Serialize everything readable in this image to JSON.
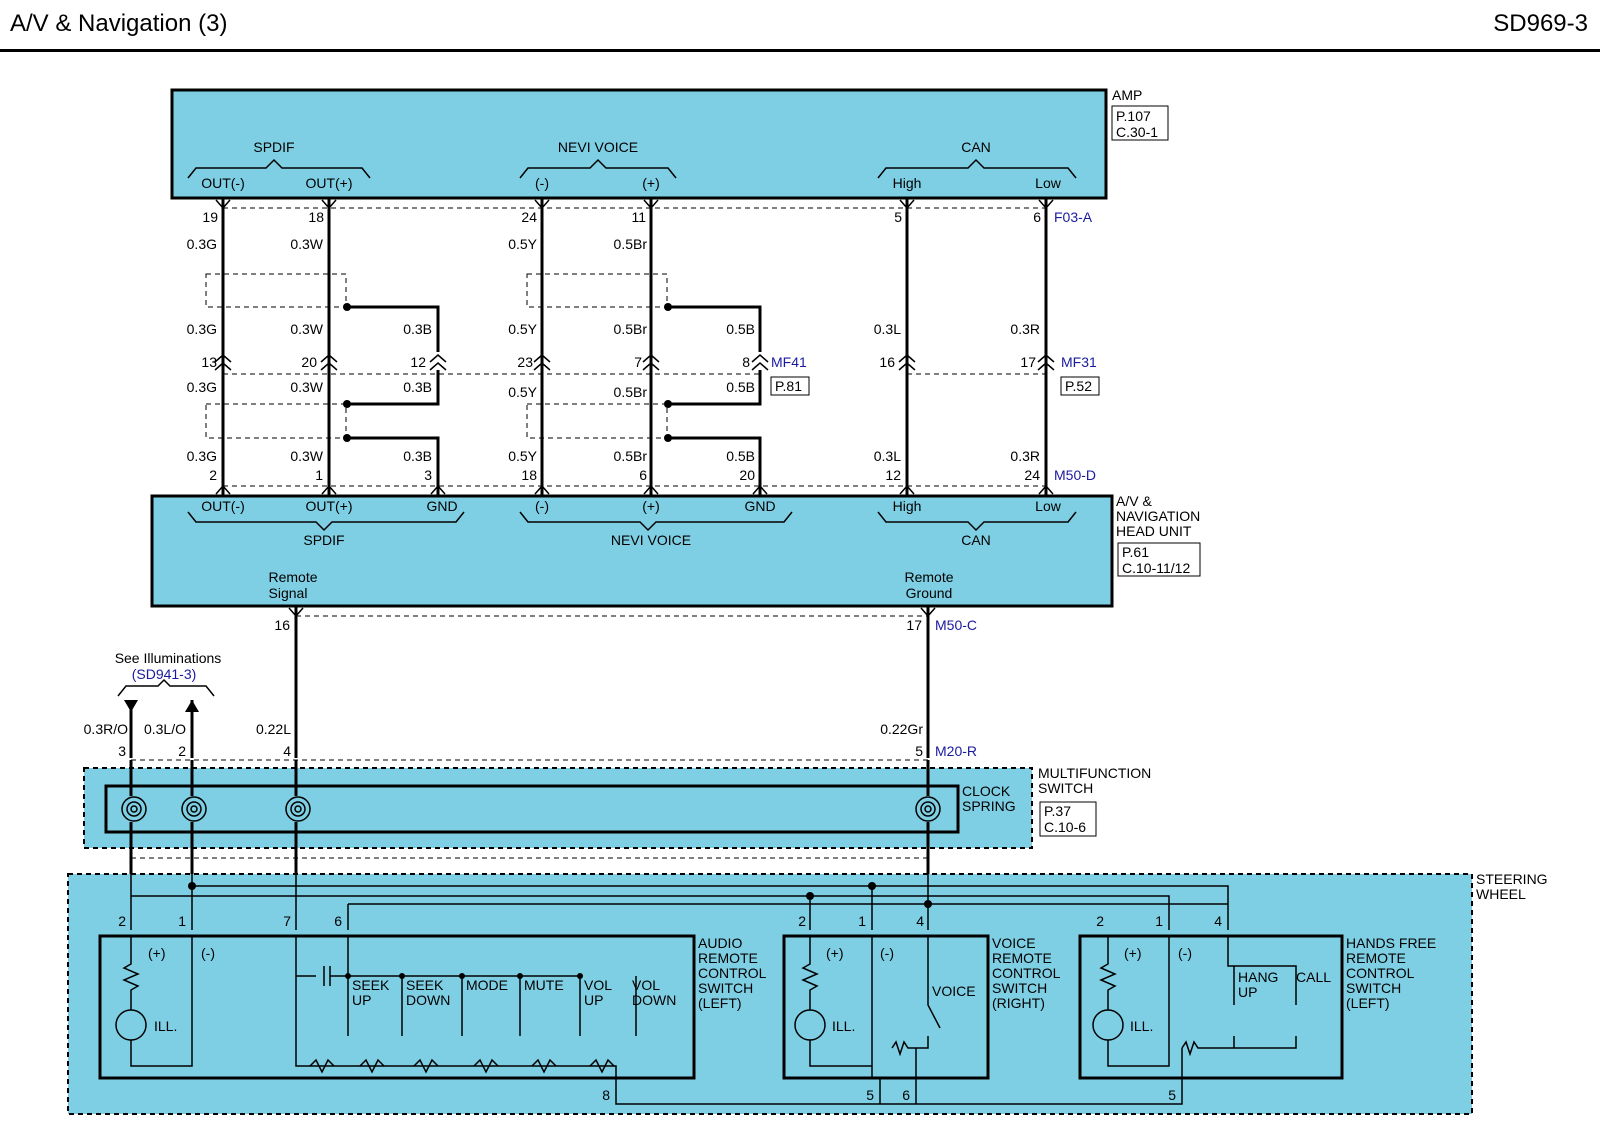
{
  "title": "A/V & Navigation (3)",
  "code": "SD969-3",
  "amp": {
    "name": "AMP",
    "ref1": "P.107",
    "ref2": "C.30-1",
    "spdif": "SPDIF",
    "navi": "NEVI VOICE",
    "can": "CAN",
    "out_minus": "OUT(-)",
    "out_plus": "OUT(+)",
    "minus": "(-)",
    "plus": "(+)",
    "high": "High",
    "low": "Low"
  },
  "connectors": {
    "f03": "F03-A",
    "mf41": "MF41",
    "mf41_ref": "P.81",
    "mf31": "MF31",
    "mf31_ref": "P.52",
    "m50d": "M50-D",
    "m50c": "M50-C",
    "m20r": "M20-R"
  },
  "head_unit": {
    "name1": "A/V &",
    "name2": "NAVIGATION",
    "name3": "HEAD UNIT",
    "ref1": "P.61",
    "ref2": "C.10-11/12",
    "spdif": "SPDIF",
    "navi": "NEVI VOICE",
    "can": "CAN",
    "gnd": "GND",
    "remote_signal_1": "Remote",
    "remote_signal_2": "Signal",
    "remote_ground_1": "Remote",
    "remote_ground_2": "Ground"
  },
  "pins": {
    "amp": [
      "19",
      "18",
      "24",
      "11",
      "5",
      "6"
    ],
    "mf": [
      "13",
      "20",
      "12",
      "23",
      "7",
      "8",
      "16",
      "17"
    ],
    "hu": [
      "2",
      "1",
      "3",
      "18",
      "6",
      "20",
      "12",
      "24"
    ],
    "m50c": [
      "16",
      "17"
    ],
    "m20r": [
      "3",
      "2",
      "4",
      "5"
    ],
    "sw_audio": [
      "2",
      "1",
      "7",
      "6",
      "8"
    ],
    "sw_voice": [
      "2",
      "1",
      "4",
      "5",
      "6"
    ],
    "sw_hf": [
      "2",
      "1",
      "4",
      "5"
    ]
  },
  "wires": {
    "g3": "0.3G",
    "w3": "0.3W",
    "b3": "0.3B",
    "y5": "0.5Y",
    "br5": "0.5Br",
    "b5": "0.5B",
    "l3": "0.3L",
    "r3": "0.3R",
    "ro": "0.3R/O",
    "lo": "0.3L/O",
    "l22": "0.22L",
    "gr22": "0.22Gr"
  },
  "illum": {
    "line1": "See Illuminations",
    "line2": "(SD941-3)"
  },
  "mfs": {
    "clock1": "CLOCK",
    "clock2": "SPRING",
    "name1": "MULTIFUNCTION",
    "name2": "SWITCH",
    "ref1": "P.37",
    "ref2": "C.10-6"
  },
  "steering": {
    "name1": "STEERING",
    "name2": "WHEEL"
  },
  "audio_sw": {
    "t1": "AUDIO",
    "t2": "REMOTE",
    "t3": "CONTROL",
    "t4": "SWITCH",
    "t5": "(LEFT)",
    "seek_up1": "SEEK",
    "seek_up2": "UP",
    "seek_down1": "SEEK",
    "seek_down2": "DOWN",
    "mode": "MODE",
    "mute": "MUTE",
    "vol_up1": "VOL",
    "vol_up2": "UP",
    "vol_down1": "VOL",
    "vol_down2": "DOWN",
    "plus": "(+)",
    "minus": "(-)",
    "ill": "ILL."
  },
  "voice_sw": {
    "t1": "VOICE",
    "t2": "REMOTE",
    "t3": "CONTROL",
    "t4": "SWITCH",
    "t5": "(RIGHT)",
    "voice": "VOICE",
    "plus": "(+)",
    "minus": "(-)",
    "ill": "ILL."
  },
  "hf_sw": {
    "t1": "HANDS FREE",
    "t2": "REMOTE",
    "t3": "CONTROL",
    "t4": "SWITCH",
    "t5": "(LEFT)",
    "hang1": "HANG",
    "hang2": "UP",
    "call": "CALL",
    "plus": "(+)",
    "minus": "(-)",
    "ill": "ILL."
  }
}
